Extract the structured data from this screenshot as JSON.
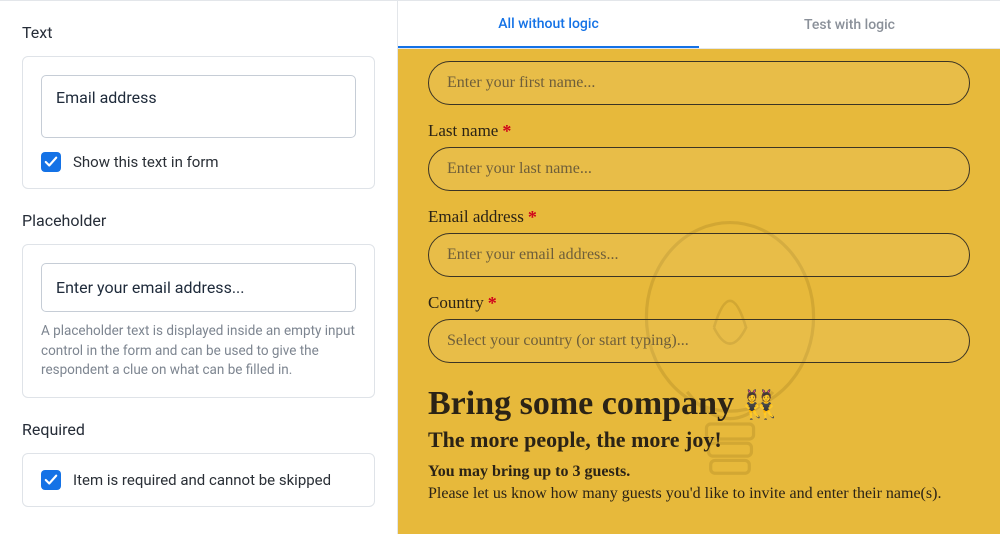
{
  "left": {
    "text_section": {
      "heading": "Text",
      "value": "Email address",
      "show_checkbox_label": "Show this text in form",
      "show_checked": true
    },
    "placeholder_section": {
      "heading": "Placeholder",
      "value": "Enter your email address...",
      "help": "A placeholder text is displayed inside an empty input control in the form and can be used to give the respondent a clue on what can be filled in."
    },
    "required_section": {
      "heading": "Required",
      "label": "Item is required and cannot be skipped",
      "checked": true
    }
  },
  "tabs": {
    "all": "All without logic",
    "test": "Test with logic"
  },
  "preview": {
    "fields": [
      {
        "label": "",
        "placeholder": "Enter your first name...",
        "required": true,
        "type": "text"
      },
      {
        "label": "Last name",
        "placeholder": "Enter your last name...",
        "required": true,
        "type": "text"
      },
      {
        "label": "Email address",
        "placeholder": "Enter your email address...",
        "required": true,
        "type": "text"
      },
      {
        "label": "Country",
        "placeholder": "Select your country (or start typing)...",
        "required": true,
        "type": "select"
      }
    ],
    "company_section": {
      "title": "Bring some company",
      "emoji": "👯",
      "subtitle": "The more people, the more joy!",
      "bold": "You may bring up to 3 guests.",
      "body": "Please let us know how many guests you'd like to invite and enter their name(s)."
    }
  }
}
